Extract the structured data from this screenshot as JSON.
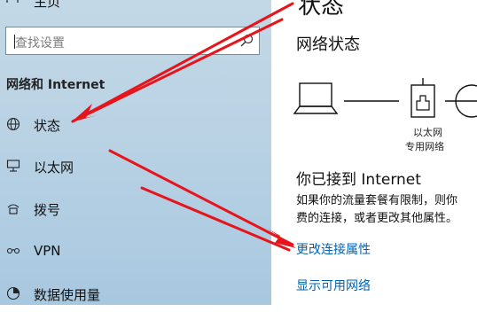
{
  "sidebar": {
    "home_label": "主页",
    "search": {
      "placeholder": "查找设置"
    },
    "section_title": "网络和 Internet",
    "items": [
      {
        "label": "状态",
        "icon": "globe-icon"
      },
      {
        "label": "以太网",
        "icon": "ethernet-icon"
      },
      {
        "label": "拨号",
        "icon": "dialup-icon"
      },
      {
        "label": "VPN",
        "icon": "vpn-icon"
      },
      {
        "label": "数据使用量",
        "icon": "data-usage-icon"
      }
    ]
  },
  "main": {
    "page_title": "状态",
    "network_status_title": "网络状态",
    "diagram": {
      "adapter_label": "以太网",
      "adapter_sub": "专用网络"
    },
    "connected_title": "你已接到 Internet",
    "description_line1": "如果你的流量套餐有限制，则你",
    "description_line2": "费的连接，或者更改其他属性。",
    "links": {
      "change_properties": "更改连接属性",
      "show_networks": "显示可用网络"
    }
  },
  "colors": {
    "accent": "#0063b1",
    "annotation_arrow": "#e8141b",
    "sidebar_bg": "#b9d2e4"
  }
}
